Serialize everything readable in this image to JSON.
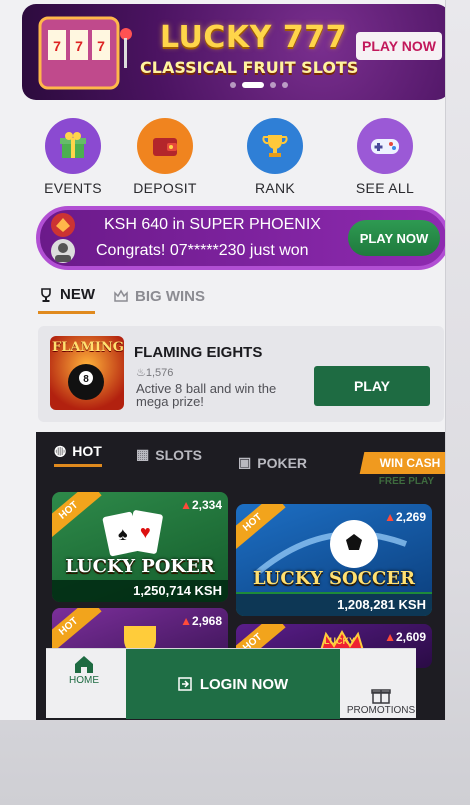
{
  "banner": {
    "title": "LUCKY 777",
    "subtitle": "CLASSICAL FRUIT SLOTS",
    "cta": "PLAY NOW"
  },
  "quick_links": [
    {
      "label": "EVENTS",
      "icon": "gift-icon",
      "color": "#8b4ad1"
    },
    {
      "label": "DEPOSIT",
      "icon": "wallet-icon",
      "color": "#f0841f"
    },
    {
      "label": "RANK",
      "icon": "trophy-icon",
      "color": "#2f7fd6"
    },
    {
      "label": "SEE ALL",
      "icon": "gamepad-icon",
      "color": "#9b59d6"
    }
  ],
  "ticker": {
    "line1": "KSH 640 in SUPER PHOENIX",
    "line2": "Congrats! 07*****230 just won",
    "cta": "PLAY NOW"
  },
  "subtabs": [
    {
      "label": "NEW",
      "icon": "trophy-outline-icon",
      "active": true
    },
    {
      "label": "BIG WINS",
      "icon": "crown-outline-icon",
      "active": false
    }
  ],
  "featured": {
    "title": "FLAMING EIGHTS",
    "count": "1,576",
    "description": "Active 8 ball and win the mega prize!",
    "cta": "PLAY",
    "thumb_text": "FLAMING"
  },
  "game_tabs": [
    {
      "label": "HOT",
      "icon": "flame-icon",
      "active": true
    },
    {
      "label": "SLOTS",
      "icon": "slot-machine-icon",
      "active": false
    },
    {
      "label": "POKER",
      "icon": "cards-icon",
      "active": false
    }
  ],
  "win_cash": "WIN CASH",
  "free_play": "FREE PLAY",
  "games": [
    {
      "name": "LUCKY POKER",
      "players": "2,334",
      "prize": "1,250,714 KSH",
      "ribbon": "HOT"
    },
    {
      "name": "LUCKY SOCCER",
      "players": "2,269",
      "prize": "1,208,281 KSH",
      "ribbon": "HOT"
    },
    {
      "name": "",
      "players": "2,968",
      "prize": "",
      "ribbon": "HOT"
    },
    {
      "name": "",
      "players": "2,609",
      "prize": "",
      "ribbon": "HOT",
      "badge": "LUCKY"
    }
  ],
  "bottom_nav": {
    "home": "HOME",
    "login": "LOGIN NOW",
    "promotions": "PROMOTIONS"
  },
  "colors": {
    "accent_green": "#1f6e45",
    "accent_orange": "#e08a1e",
    "ticker_purple": "#7b21a0"
  }
}
